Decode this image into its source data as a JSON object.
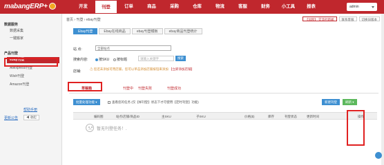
{
  "topbar": {
    "logo": "mabangERP+",
    "nav": [
      "开发",
      "刊登",
      "订单",
      "商品",
      "采购",
      "仓库",
      "物流",
      "客服",
      "财务",
      "小工具",
      "报表"
    ],
    "active_nav": "刊登",
    "user": "admin"
  },
  "sidebar": {
    "groups": [
      {
        "label": "数据服务",
        "items": [
          "数据采集",
          "一键搬家"
        ]
      },
      {
        "label": "产品刊登",
        "items": [
          "ebay刊登",
          "Aliexpress刊登",
          "Wish刊登",
          "Amazon刊登"
        ]
      }
    ],
    "active_item": "ebay刊登",
    "help_link": "帮助手册",
    "update_link": "更新公告",
    "collapse_btn": "◀ 收起"
  },
  "main": {
    "breadcrumb": "首页 › 刊登 › ebay刊登",
    "header_buttons": [
      "【远程】 交流社新闻",
      "联系客服",
      "切换旧版本"
    ],
    "tabs": [
      "Ebay刊登",
      "Ebay在线商品",
      "ebay刊登模板",
      "ebay商品刊登统计"
    ],
    "site_label": "站 点:",
    "site_value": "全部站点",
    "search_label": "搜索内容:",
    "radio_sku": "按SKU",
    "radio_title": "按标题",
    "search_placeholder": "请输入关键字",
    "search_btn": "搜索",
    "store_label": "店铺:",
    "notice": "⚠ 您还未添加可用店铺，您可以单击添加店铺按钮来添加 ",
    "notice_link": "【立即添加店铺】",
    "status_tabs": [
      "草稿箱",
      "刊登中",
      "刊登失败",
      "刊登成功"
    ],
    "bulk_btn": "批量处理功能 ▾",
    "filter_text": "查看您的任务 (仅【样刊登】状态下才可使用【定时刊登】功能)",
    "new_btn": "新建刊登",
    "refresh_btn": "刷新 ▾",
    "columns": [
      "编码图",
      "站点/店铺/商品ID",
      "主SKU",
      "子SKU",
      "价格($)",
      "库存",
      "刊登状态",
      "更新时间",
      "操作"
    ],
    "empty": "暂无刊登任务！."
  }
}
